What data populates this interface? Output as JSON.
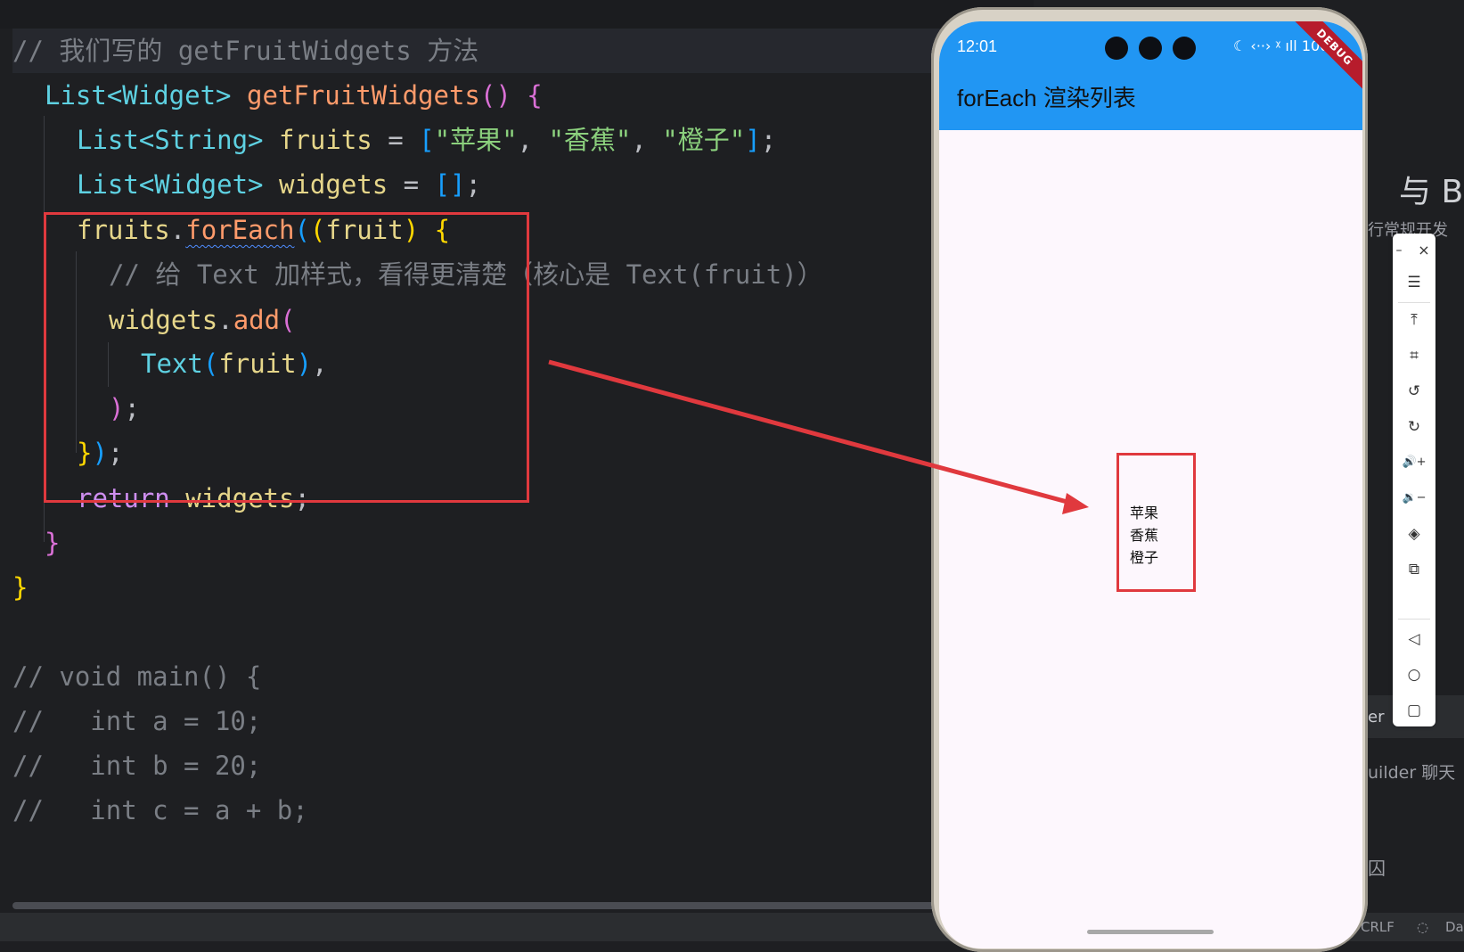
{
  "editor": {
    "lines": {
      "l1_comment": "// 我们写的 getFruitWidgets 方法",
      "l2_type": "List<Widget>",
      "l2_fn": "getFruitWidgets",
      "l2_paren": "()",
      "l2_brace": "{",
      "l3_type": "List<String>",
      "l3_var": "fruits",
      "l3_eq": " = ",
      "l3_open": "[",
      "l3_s1": "\"苹果\"",
      "l3_comma1": ", ",
      "l3_s2": "\"香蕉\"",
      "l3_comma2": ", ",
      "l3_s3": "\"橙子\"",
      "l3_close": "]",
      "l3_semi": ";",
      "l4_type": "List<Widget>",
      "l4_var": "widgets",
      "l4_eq": " = ",
      "l4_arr": "[]",
      "l4_semi": ";",
      "l5_var": "fruits",
      "l5_dot": ".",
      "l5_fn": "forEach",
      "l5_p1": "(",
      "l5_p2": "(",
      "l5_param": "fruit",
      "l5_p3": ")",
      "l5_brace": " {",
      "l6_comment": "// 给 Text 加样式，看得更清楚（核心是 Text(fruit)）",
      "l7_var": "widgets",
      "l7_dot": ".",
      "l7_fn": "add",
      "l7_paren": "(",
      "l8_type": "Text",
      "l8_open": "(",
      "l8_arg": "fruit",
      "l8_close": ")",
      "l8_comma": ",",
      "l9_paren": ")",
      "l9_semi": ";",
      "l10_brace": "}",
      "l10_paren": ")",
      "l10_semi": ";",
      "l11_kw": "return",
      "l11_var": " widgets",
      "l11_semi": ";",
      "l12_brace": "}",
      "l13_brace": "}",
      "l15": "// void main() {",
      "l16": "//   int a = 10;",
      "l17": "//   int b = 20;",
      "l18": "//   int c = a + b;"
    }
  },
  "phone": {
    "time": "12:01",
    "status_icons": "☾ ‹··› ᵡ ıll 100",
    "app_title": "forEach 渲染列表",
    "debug_banner": "DEBUG",
    "fruits": [
      "苹果",
      "香蕉",
      "橙子"
    ]
  },
  "right_panel": {
    "partial_heading": "与 B",
    "partial_sub": "行常规开发",
    "partial_tab": "er",
    "partial_builder": "uilder 聊天",
    "partial_glyph": "囚",
    "status_crlf": "CRLF",
    "status_da": "Da"
  },
  "emulator_toolbar": {
    "minimize": "–",
    "close": "×",
    "menu": "☰",
    "pin_top": "⤒",
    "crop": "⌗",
    "rotate_left": "↺",
    "rotate_right": "↻",
    "volume_up": "🔊+",
    "volume_down": "🔉−",
    "shake": "◈",
    "fold": "⧉",
    "back": "◁",
    "home": "○",
    "overview": "▢"
  },
  "colors": {
    "editor_bg": "#1e1f22",
    "app_bar": "#2196f3",
    "annotation_red": "#e0393e",
    "debug_banner": "#b71c2c"
  }
}
